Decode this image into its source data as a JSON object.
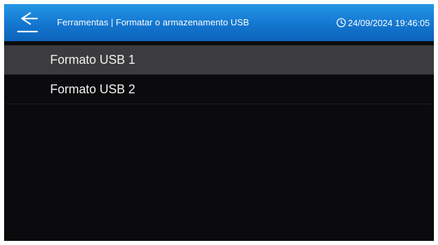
{
  "header": {
    "back_icon": "back-arrow-icon",
    "title": "Ferramentas | Formatar o armazenamento USB",
    "clock_icon": "clock-icon",
    "datetime": "24/09/2024 19:46:05"
  },
  "list": {
    "items": [
      {
        "label": "Formato USB 1",
        "selected": true
      },
      {
        "label": "Formato USB 2",
        "selected": false
      }
    ]
  },
  "colors": {
    "header_top": "#2496e6",
    "header_bottom": "#0d63bb",
    "background": "#0b0a0d",
    "selected_row": "#3c3c3e",
    "text": "#f2f2f2"
  }
}
